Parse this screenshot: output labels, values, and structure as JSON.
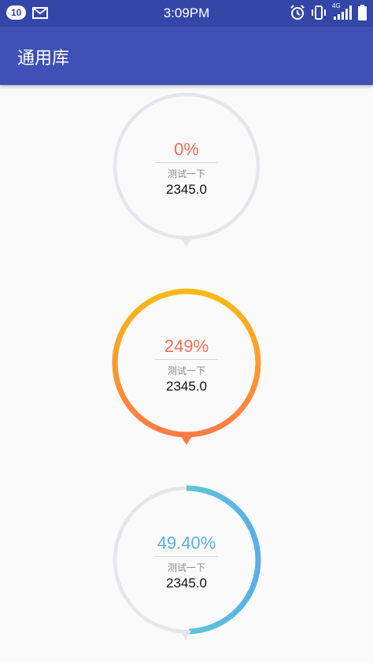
{
  "status_bar": {
    "notification_count": "10",
    "time": "3:09PM",
    "network_type": "4G",
    "icons": [
      "mail-icon",
      "alarm-icon",
      "vibrate-icon",
      "signal-icon",
      "battery-icon"
    ]
  },
  "app_bar": {
    "title": "通用库",
    "color": "#3f51b5"
  },
  "gauges": [
    {
      "percent_text": "0%",
      "percent_color": "#f0705a",
      "label": "测试一下",
      "value": "2345.0",
      "progress": 0,
      "track_color": "#e3e6ea"
    },
    {
      "percent_text": "249%",
      "percent_color": "#f0705a",
      "label": "测试一下",
      "value": "2345.0",
      "progress": 1,
      "gradient": [
        "#fbb917",
        "#ff7b45"
      ]
    },
    {
      "percent_text": "49.40%",
      "percent_color": "#5aaee8",
      "label": "测试一下",
      "value": "2345.0",
      "progress": 0.494,
      "gradient": [
        "#63e0c0",
        "#5aaee8"
      ],
      "track_color": "#e3e6ea"
    }
  ]
}
